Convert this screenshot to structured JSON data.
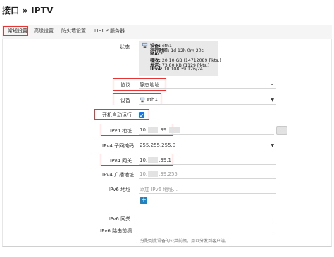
{
  "page": {
    "title": "接口 » IPTV"
  },
  "tabs": [
    {
      "label": "常规设置",
      "active": true
    },
    {
      "label": "高级设置",
      "active": false
    },
    {
      "label": "防火墙设置",
      "active": false
    },
    {
      "label": "DHCP 服务器",
      "active": false
    }
  ],
  "status": {
    "label": "状态",
    "device_key": "设备:",
    "device_val": "eth1",
    "uptime_key": "运行时间:",
    "uptime_val": "1d 12h 0m 20s",
    "mac_key": "MAC:",
    "rx_key": "接收:",
    "rx_val": "20.10 GB (14712089 Pkts.)",
    "tx_key": "发送:",
    "tx_val": "73.80 KB (1129 Pkts.)",
    "ipv4_key": "IPv4:",
    "ipv4_val": "10.108.39.126/24"
  },
  "protocol": {
    "label": "协议",
    "value": "静态地址",
    "icon": "chevron-down-icon"
  },
  "device": {
    "label": "设备",
    "value": "eth1",
    "icon": "network-icon"
  },
  "autostart": {
    "label": "开机自动运行",
    "checked": true
  },
  "ipv4_addr": {
    "label": "IPv4 地址",
    "prefix": "10.",
    "mid": ".39.",
    "action": "..."
  },
  "netmask": {
    "label": "IPv4 子网掩码",
    "value": "255.255.255.0"
  },
  "gateway": {
    "label": "IPv4 网关",
    "prefix": "10.",
    "suffix": ".39.1"
  },
  "broadcast": {
    "label": "IPv4 广播地址",
    "prefix": "10.",
    "suffix": ".39.255"
  },
  "ipv6_addr": {
    "label": "IPv6 地址",
    "placeholder": "添加 IPv6 地址...",
    "add": "+"
  },
  "ipv6_gw": {
    "label": "IPv6 网关"
  },
  "ipv6_prefix": {
    "label": "IPv6 路由前缀",
    "help": "分配到此设备的公共前缀，用以分发到客户端。"
  },
  "colors": {
    "highlight": "#e53535",
    "accent": "#1a73e8",
    "status_bg": "#e9e9e9"
  }
}
